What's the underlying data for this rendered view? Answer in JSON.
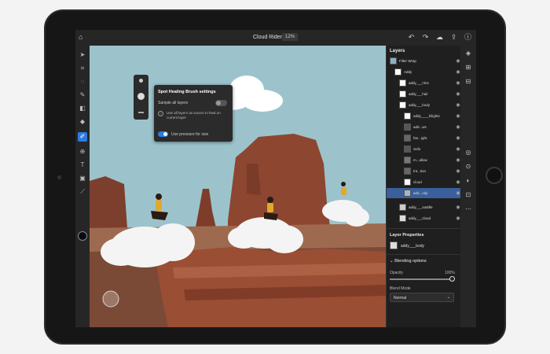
{
  "document": {
    "title": "Cloud Riders",
    "zoom": "12%"
  },
  "brush_popup": {
    "title": "Spot Healing Brush settings",
    "sample_all_label": "Sample all layers",
    "hint_text": "Use all layers as source to heal on current layer",
    "pressure_label": "Use pressure for size"
  },
  "layers": {
    "title": "Layers",
    "items": [
      {
        "label": "Filter Wrap"
      },
      {
        "label": "Addy"
      },
      {
        "label": "addy___rims"
      },
      {
        "label": "addy___hair"
      },
      {
        "label": "addy___body"
      },
      {
        "label": "addy____hilights"
      },
      {
        "label": "add...ws"
      },
      {
        "label": "fan...ight"
      },
      {
        "label": "Sofo"
      },
      {
        "label": "m...allow"
      },
      {
        "label": "tnt...tion"
      },
      {
        "label": "cloud"
      },
      {
        "label": "add...ody"
      },
      {
        "label": "addy___saddle"
      },
      {
        "label": "addy___cloud"
      }
    ]
  },
  "layer_properties": {
    "title": "Layer Properties",
    "layer_name": "addy___body",
    "blending_title": "Blending options",
    "opacity_label": "Opacity",
    "opacity_value": "100%",
    "blend_mode_label": "Blend Mode",
    "blend_mode_value": "Normal"
  },
  "colors": {
    "accent": "#2d7be0",
    "panel": "#262626",
    "selected_row": "#3a5f9c"
  },
  "icons": {
    "toolbar": [
      "move-icon",
      "crop-icon",
      "lasso-icon",
      "brush-icon",
      "eraser-icon",
      "paint-bucket-icon",
      "healing-brush-icon",
      "clone-icon",
      "type-icon",
      "image-icon",
      "eyedropper-icon"
    ],
    "topbar_right": [
      "undo-icon",
      "redo-icon",
      "cloud-icon",
      "share-icon",
      "help-icon"
    ]
  }
}
